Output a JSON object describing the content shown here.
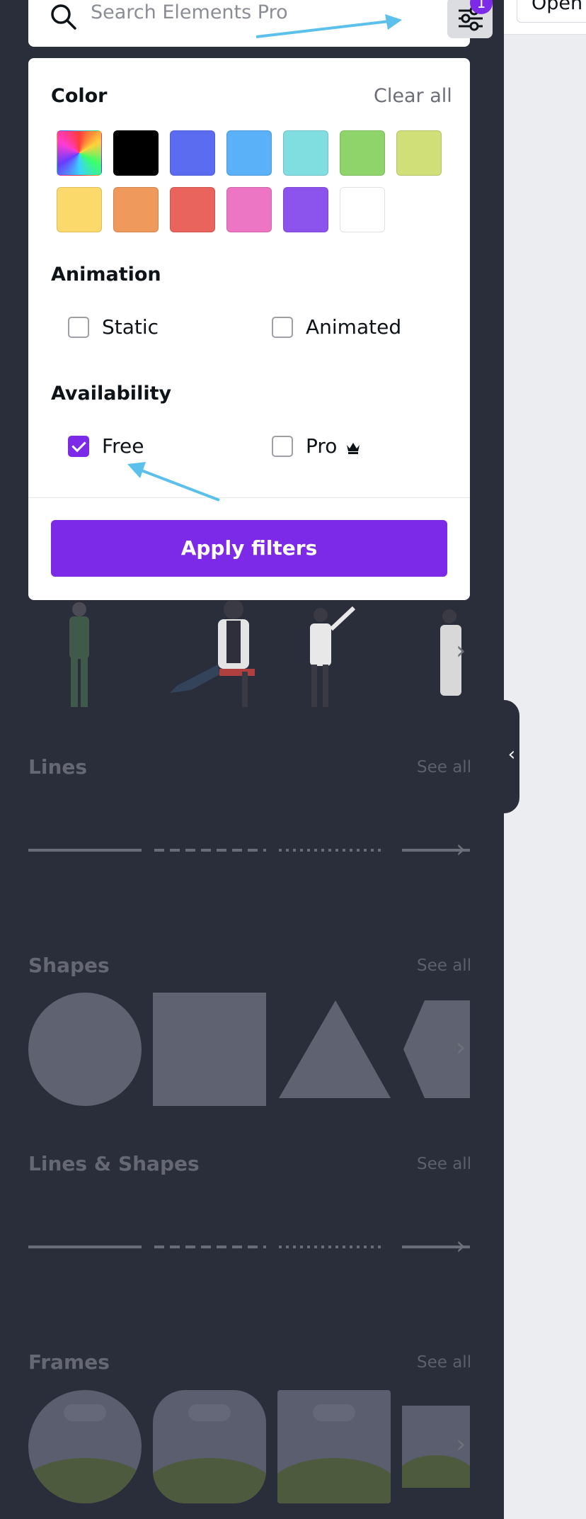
{
  "search": {
    "placeholder": "Search Elements Pro",
    "filter_badge": "1"
  },
  "top_bar": {
    "open_button": "Open"
  },
  "filter_panel": {
    "color_heading": "Color",
    "clear_all": "Clear all",
    "colors": [
      "rainbow",
      "#000000",
      "#5b6cf0",
      "#5ab1f7",
      "#80dde0",
      "#8fd46a",
      "#d1df79",
      "#fbd96b",
      "#ef9a5c",
      "#e8645c",
      "#ec76c3",
      "#8c54ed",
      "#ffffff"
    ],
    "animation_heading": "Animation",
    "animation_options": [
      {
        "label": "Static",
        "checked": false
      },
      {
        "label": "Animated",
        "checked": false
      }
    ],
    "availability_heading": "Availability",
    "availability_options": [
      {
        "label": "Free",
        "checked": true
      },
      {
        "label": "Pro",
        "checked": false
      }
    ],
    "apply_button": "Apply filters"
  },
  "sections": [
    {
      "title": "Lines",
      "see_all": "See all"
    },
    {
      "title": "Shapes",
      "see_all": "See all"
    },
    {
      "title": "Lines & Shapes",
      "see_all": "See all"
    },
    {
      "title": "Frames",
      "see_all": "See all"
    }
  ],
  "icons": [
    "search-icon",
    "filter-sliders-icon",
    "checkmark-icon",
    "crown-icon",
    "chevron-right-icon",
    "chevron-left-icon"
  ],
  "colors": {
    "accent": "#7d2ae8",
    "sidebar_bg": "#2a2d3a",
    "annotation_arrow": "#5bc0eb"
  }
}
